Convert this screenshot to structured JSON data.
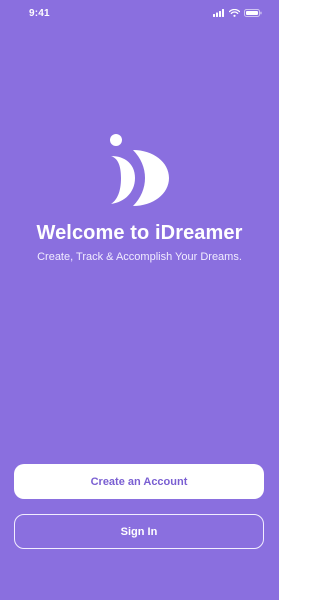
{
  "status_bar": {
    "time": "9:41",
    "icons": [
      "signal-icon",
      "wifi-icon",
      "battery-icon"
    ]
  },
  "welcome": {
    "logo": "idreamer-logo",
    "title": "Welcome to iDreamer",
    "subtitle": "Create, Track & Accomplish Your Dreams."
  },
  "actions": {
    "create_account_label": "Create an Account",
    "sign_in_label": "Sign In"
  },
  "colors": {
    "background": "#8A6FDF",
    "primary_button_bg": "#FFFFFF",
    "primary_button_text": "#7A5FD2",
    "text": "#FFFFFF"
  }
}
